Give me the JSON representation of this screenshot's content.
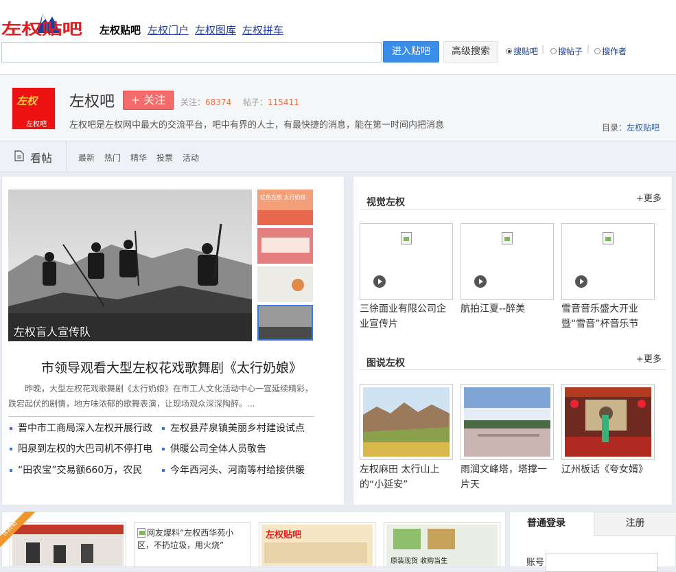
{
  "header": {
    "logo_text": "左权贴吧",
    "links": [
      "左权贴吧",
      "左权门户",
      "左权图库",
      "左权拼车"
    ],
    "search_value": "",
    "enter_label": "进入贴吧",
    "advanced_label": "高级搜索",
    "radios": [
      "搜贴吧",
      "搜帖子",
      "搜作者"
    ],
    "radio_selected": "搜贴吧",
    "separator": "|"
  },
  "forum": {
    "icon_text_top": "左权",
    "icon_text_bottom": "左权吧",
    "name": "左权吧",
    "follow_label": "+ 关注",
    "follow_prefix": "关注：",
    "follow_count": "68374",
    "posts_prefix": "帖子：",
    "posts_count": "115411",
    "description": "左权吧是左权网中最大的交流平台，吧中有界的人士，有最快捷的消息，能在第一时间内把消息",
    "catalog_prefix": "目录：",
    "catalog_link": "左权贴吧"
  },
  "nav": {
    "view_label": "看帖",
    "items": [
      "最新",
      "热门",
      "精华",
      "投票",
      "活动"
    ]
  },
  "feature": {
    "slide_caption": "左权盲人宣传队",
    "headline": "市领导观看大型左权花戏歌舞剧《太行奶娘》",
    "summary": "昨晚，大型左权花戏歌舞剧《太行奶娘》在市工人文化活动中心一宣延续精彩，跌宕起伏的剧情，地方味浓郁的歌舞表演，让现场观众深深陶醉。...",
    "thumb1_text": "红色左权 太行奶娘",
    "news": [
      "晋中市工商局深入左权开展行政",
      "左权县芹泉镇美丽乡村建设试点",
      "阳泉到左权的大巴司机不停打电",
      "供暖公司全体人员敬告",
      "“田农宝”交易额660万，农民",
      "今年西河头、河南等村给接供暖"
    ]
  },
  "visual": {
    "title": "视觉左权",
    "more": "+更多",
    "videos": [
      "三徐面业有限公司企业宣传片",
      "航拍江夏--醉美",
      "雪音音乐盛大开业暨“雪音”杯音乐节"
    ]
  },
  "pictures": {
    "title": "图说左权",
    "more": "+更多",
    "items": [
      "左权麻田 太行山上的“小延安”",
      "雨润文峰塔，塔撑一片天",
      "辽州板话《夸女婿》"
    ]
  },
  "bottom": {
    "ribbon": "优质帖",
    "card2_alt": "网友爆料“左权西华苑小区，不扔垃圾，用火烧”",
    "card3_text": "左权贴吧",
    "card4_text": "原装现货 收购当生"
  },
  "login": {
    "tab_login": "普通登录",
    "tab_register": "注册",
    "account_label": "账号"
  }
}
